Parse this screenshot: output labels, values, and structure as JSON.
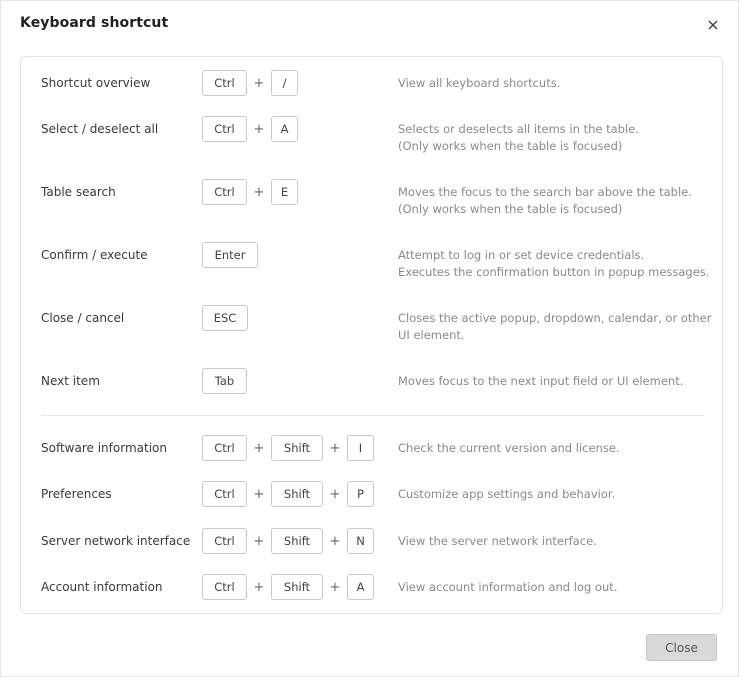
{
  "dialog": {
    "title": "Keyboard shortcut",
    "close_label": "Close"
  },
  "shortcuts": [
    {
      "label": "Shortcut overview",
      "keys": [
        "Ctrl",
        "/"
      ],
      "desc": [
        "View all keyboard shortcuts."
      ]
    },
    {
      "label": "Select / deselect all",
      "keys": [
        "Ctrl",
        "A"
      ],
      "desc": [
        "Selects or deselects all items in the table.",
        "(Only works when the table is focused)"
      ]
    },
    {
      "label": "Table search",
      "keys": [
        "Ctrl",
        "E"
      ],
      "desc": [
        "Moves the focus to the search bar above the table.",
        "(Only works when the table is focused)"
      ]
    },
    {
      "label": "Confirm / execute",
      "keys": [
        "Enter"
      ],
      "desc": [
        "Attempt to log in or set device credentials.",
        "Executes the confirmation button in popup messages."
      ]
    },
    {
      "label": "Close / cancel",
      "keys": [
        "ESC"
      ],
      "desc": [
        "Closes the active popup, dropdown, calendar, or other",
        "UI element."
      ]
    },
    {
      "label": "Next item",
      "keys": [
        "Tab"
      ],
      "desc": [
        "Moves focus to the next input field or UI element."
      ]
    },
    {
      "label": "Software information",
      "keys": [
        "Ctrl",
        "Shift",
        "I"
      ],
      "desc": [
        "Check the current version and license."
      ]
    },
    {
      "label": "Preferences",
      "keys": [
        "Ctrl",
        "Shift",
        "P"
      ],
      "desc": [
        "Customize app settings and behavior."
      ]
    },
    {
      "label": "Server network interface",
      "keys": [
        "Ctrl",
        "Shift",
        "N"
      ],
      "desc": [
        "View the server network interface."
      ]
    },
    {
      "label": "Account information",
      "keys": [
        "Ctrl",
        "Shift",
        "A"
      ],
      "desc": [
        "View account information and log out."
      ]
    }
  ],
  "plus_symbol": "+",
  "icons": {
    "close": "close-icon"
  }
}
